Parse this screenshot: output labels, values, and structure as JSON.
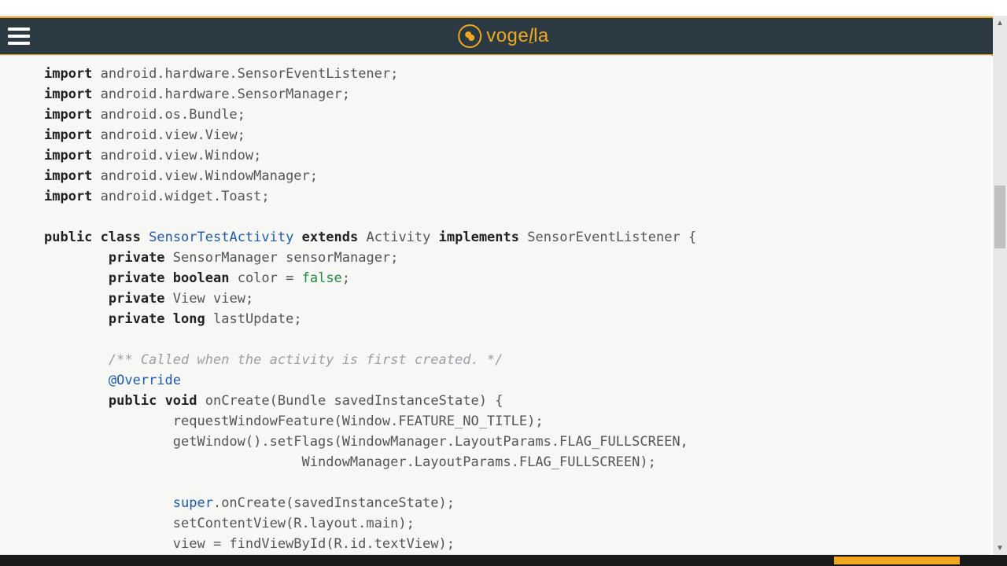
{
  "header": {
    "logo_prefix": "voge",
    "logo_mid": "l",
    "logo_suffix": "la"
  },
  "code": {
    "kw_import": "import",
    "kw_public": "public",
    "kw_class": "class",
    "kw_extends": "extends",
    "kw_implements": "implements",
    "kw_private": "private",
    "kw_void": "void",
    "kw_super": "super",
    "imports": [
      "android.hardware.SensorEventListener;",
      "android.hardware.SensorManager;",
      "android.os.Bundle;",
      "android.view.View;",
      "android.view.Window;",
      "android.view.WindowManager;",
      "android.widget.Toast;"
    ],
    "class_name": "SensorTestActivity",
    "superclass": "Activity",
    "interface": "SensorEventListener",
    "fields": [
      {
        "type": "SensorManager",
        "name": "sensorManager"
      },
      {
        "type": "boolean",
        "name": "color",
        "value": "false"
      },
      {
        "type": "View",
        "name": "view"
      },
      {
        "type": "long",
        "name": "lastUpdate"
      }
    ],
    "comment": "/** Called when the activity is first created. */",
    "override": "@Override",
    "method_sig": "onCreate(Bundle savedInstanceState)",
    "body": [
      "requestWindowFeature(Window.FEATURE_NO_TITLE);",
      "getWindow().setFlags(WindowManager.LayoutParams.FLAG_FULLSCREEN,",
      "WindowManager.LayoutParams.FLAG_FULLSCREEN);",
      ".onCreate(savedInstanceState);",
      "setContentView(R.layout.main);",
      "view = findViewById(R.id.textView);"
    ]
  }
}
